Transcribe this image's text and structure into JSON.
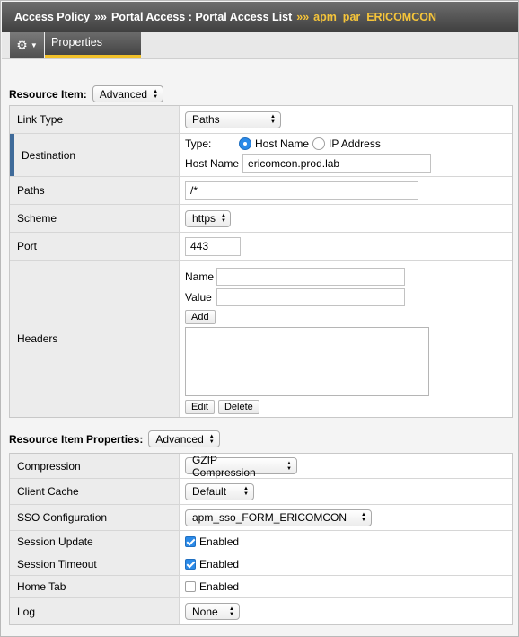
{
  "breadcrumb": {
    "items": [
      "Access Policy",
      "Portal Access : Portal Access List"
    ],
    "separator": "»»",
    "current": "apm_par_ERICOMCON"
  },
  "tabs": {
    "properties": "Properties"
  },
  "resource_item": {
    "header": "Resource Item:",
    "mode": "Advanced",
    "link_type": {
      "label": "Link Type",
      "value": "Paths"
    },
    "destination": {
      "label": "Destination",
      "type_label": "Type:",
      "option_host": "Host Name",
      "option_ip": "IP Address",
      "host_label": "Host Name",
      "host_value": "ericomcon.prod.lab"
    },
    "paths": {
      "label": "Paths",
      "value": "/*"
    },
    "scheme": {
      "label": "Scheme",
      "value": "https"
    },
    "port": {
      "label": "Port",
      "value": "443"
    },
    "headers": {
      "label": "Headers",
      "name_label": "Name",
      "value_label": "Value",
      "add_label": "Add",
      "edit_label": "Edit",
      "delete_label": "Delete"
    }
  },
  "resource_item_properties": {
    "header": "Resource Item Properties:",
    "mode": "Advanced",
    "compression": {
      "label": "Compression",
      "value": "GZIP Compression"
    },
    "client_cache": {
      "label": "Client Cache",
      "value": "Default"
    },
    "sso": {
      "label": "SSO Configuration",
      "value": "apm_sso_FORM_ERICOMCON"
    },
    "session_update": {
      "label": "Session Update",
      "checkbox_label": "Enabled",
      "checked": true
    },
    "session_timeout": {
      "label": "Session Timeout",
      "checkbox_label": "Enabled",
      "checked": true
    },
    "home_tab": {
      "label": "Home Tab",
      "checkbox_label": "Enabled",
      "checked": false
    },
    "log": {
      "label": "Log",
      "value": "None"
    }
  },
  "icons": {
    "gear": "gear-icon",
    "select_arrows": "updown-arrows-icon"
  },
  "colors": {
    "accent": "#f0c02a",
    "breadcrumb_current": "#f5c43a",
    "check_blue": "#2b8ae8",
    "marker": "#3f6b9a"
  }
}
